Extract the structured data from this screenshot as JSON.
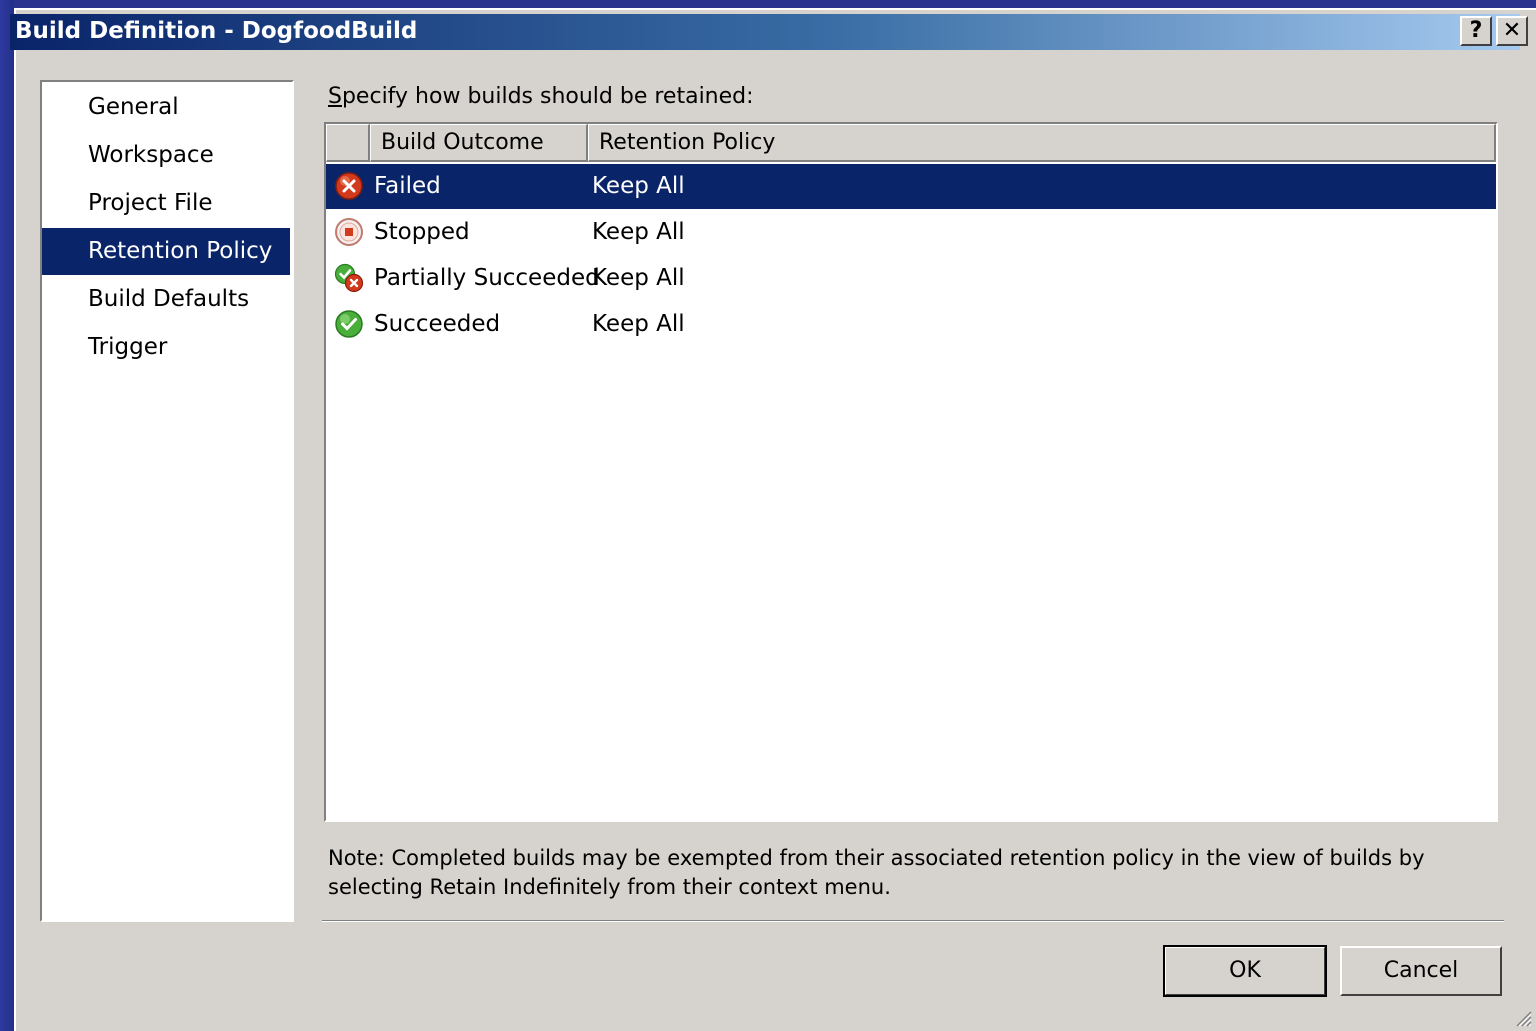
{
  "window": {
    "title": "Build Definition - DogfoodBuild",
    "help_label": "?",
    "close_label": "✕"
  },
  "nav": {
    "items": [
      {
        "label": "General",
        "selected": false
      },
      {
        "label": "Workspace",
        "selected": false
      },
      {
        "label": "Project File",
        "selected": false
      },
      {
        "label": "Retention Policy",
        "selected": true
      },
      {
        "label": "Build Defaults",
        "selected": false
      },
      {
        "label": "Trigger",
        "selected": false
      }
    ]
  },
  "main": {
    "instruction_accel": "S",
    "instruction_rest": "pecify how builds should be retained:",
    "columns": [
      "Build Outcome",
      "Retention Policy"
    ],
    "rows": [
      {
        "outcome": "Failed",
        "policy": "Keep All",
        "icon": "failed-icon",
        "selected": true
      },
      {
        "outcome": "Stopped",
        "policy": "Keep All",
        "icon": "stopped-icon",
        "selected": false
      },
      {
        "outcome": "Partially Succeeded",
        "policy": "Keep All",
        "icon": "partially-succeeded-icon",
        "selected": false
      },
      {
        "outcome": "Succeeded",
        "policy": "Keep All",
        "icon": "succeeded-icon",
        "selected": false
      }
    ],
    "note_line1": "Note: Completed builds may be exempted from their associated retention policy in the view of builds by",
    "note_line2": "selecting Retain Indefinitely from their context menu."
  },
  "buttons": {
    "ok": "OK",
    "cancel": "Cancel"
  },
  "colors": {
    "selection": "#0a246a",
    "dialog_face": "#d6d3ce",
    "desktop": "#26318f"
  }
}
